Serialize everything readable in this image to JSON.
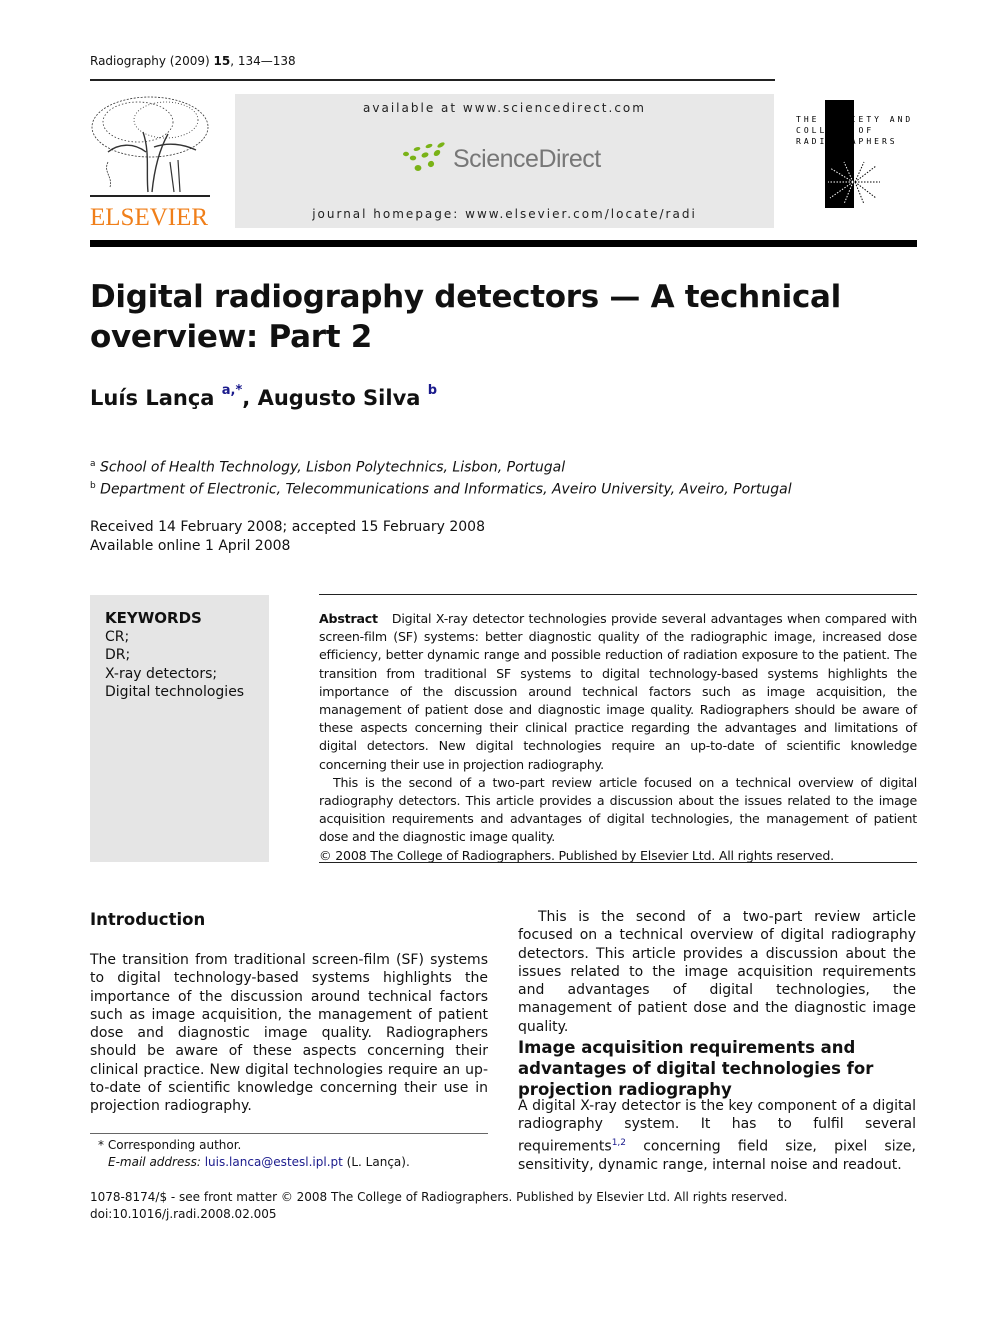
{
  "header": {
    "journal": "Radiography (2009)",
    "volume": "15",
    "pages": ", 134—138",
    "publisher_logo_text": "ELSEVIER",
    "banner": {
      "available": "available at www.sciencedirect.com",
      "brand": "ScienceDirect",
      "homepage": "journal homepage: www.elsevier.com/locate/radi"
    },
    "society_logo_text": "THE SOCIETY AND\nCOLLEGE OF\nRADIOGRAPHERS"
  },
  "article": {
    "title": "Digital radiography detectors — A technical overview: Part 2",
    "authors": [
      {
        "name": "Luís Lança",
        "marks": "a,*"
      },
      {
        "name": "Augusto Silva",
        "marks": "b"
      }
    ],
    "affiliations": [
      {
        "mark": "a",
        "text": "School of Health Technology, Lisbon Polytechnics, Lisbon, Portugal"
      },
      {
        "mark": "b",
        "text": "Department of Electronic, Telecommunications and Informatics, Aveiro University, Aveiro, Portugal"
      }
    ],
    "received": "Received 14 February 2008; accepted 15 February 2008",
    "available_online": "Available online 1 April 2008"
  },
  "keywords": {
    "title": "KEYWORDS",
    "items": [
      "CR;",
      "DR;",
      "X-ray detectors;",
      "Digital technologies"
    ]
  },
  "abstract": {
    "label": "Abstract",
    "p1": "Digital X-ray detector technologies provide several advantages when compared with screen-film (SF) systems: better diagnostic quality of the radiographic image, increased dose efficiency, better dynamic range and possible reduction of radiation exposure to the patient. The transition from traditional SF systems to digital technology-based systems highlights the importance of the discussion around technical factors such as image acquisition, the management of patient dose and diagnostic image quality. Radiographers should be aware of these aspects concerning their clinical practice regarding the advantages and limitations of digital detectors. New digital technologies require an up-to-date of scientific knowledge concerning their use in projection radiography.",
    "p2": "This is the second of a two-part review article focused on a technical overview of digital radiography detectors. This article provides a discussion about the issues related to the image acquisition requirements and advantages of digital technologies, the management of patient dose and the diagnostic image quality.",
    "copyright": "© 2008 The College of Radiographers. Published by Elsevier Ltd. All rights reserved."
  },
  "body": {
    "intro_heading": "Introduction",
    "intro_text": "The transition from traditional screen-film (SF) systems to digital technology-based systems highlights the importance of the discussion around technical factors such as image acquisition, the management of patient dose and diagnostic image quality. Radiographers should be aware of these aspects concerning their clinical practice. New digital technologies require an up-to-date of scientific knowledge concerning their use in projection radiography.",
    "right_p1": "This is the second of a two-part review article focused on a technical overview of digital radiography detectors. This article provides a discussion about the issues related to the image acquisition requirements and advantages of digital technologies, the management of patient dose and the diagnostic image quality.",
    "section2_heading": "Image acquisition requirements and advantages of digital technologies for projection radiography",
    "section2_text_a": "A digital X-ray detector is the key component of a digital radiography system. It has to fulfil several requirements",
    "section2_ref": "1,2",
    "section2_text_b": " concerning field size, pixel size, sensitivity, dynamic range, internal noise and readout."
  },
  "footnote": {
    "corresponding": "* Corresponding author.",
    "email_label": "E-mail address:",
    "email": "luis.lanca@estesl.ipl.pt",
    "email_suffix": " (L. Lança)."
  },
  "imprint": {
    "line1": "1078-8174/$ - see front matter © 2008 The College of Radiographers. Published by Elsevier Ltd. All rights reserved.",
    "doi": "doi:10.1016/j.radi.2008.02.005"
  },
  "colors": {
    "elsevier_orange": "#f07f1a",
    "sciencedirect_green": "#7ab317",
    "link_blue": "#1a1a8c",
    "panel_gray": "#e5e5e5"
  }
}
